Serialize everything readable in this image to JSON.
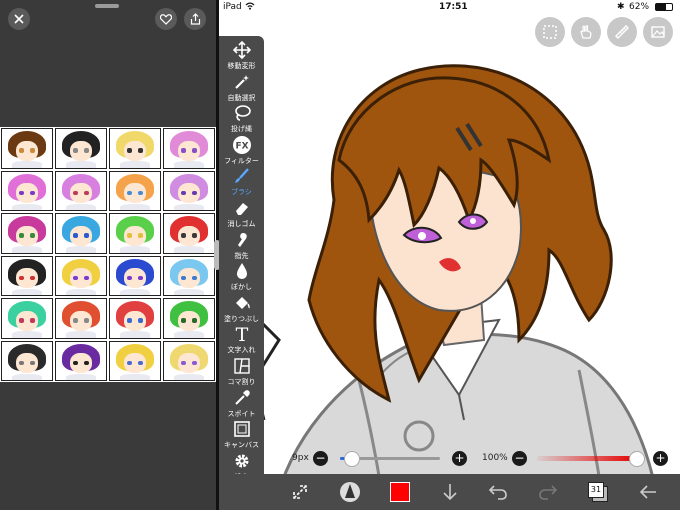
{
  "colors": {
    "accent": "#5aa8ff",
    "current_color": "#ff0000",
    "toolbar_bg": "#4a4a4a",
    "hair_main": "#a0550f"
  },
  "status_bar": {
    "device": "iPad",
    "time": "17:51",
    "battery": "62%",
    "battery_level": 0.62
  },
  "left_pane": {
    "icons": [
      "close-icon",
      "heart-icon",
      "share-icon"
    ]
  },
  "top_tools": [
    "selection-icon",
    "hand-icon",
    "ruler-icon",
    "image-icon"
  ],
  "toolbar": {
    "items": [
      {
        "label": "移動変形",
        "icon": "move-transform-icon"
      },
      {
        "label": "自動選択",
        "icon": "magic-wand-icon"
      },
      {
        "label": "投げ縄",
        "icon": "lasso-icon"
      },
      {
        "label": "フィルター",
        "icon": "fx-filter-icon",
        "glyph": "FX"
      },
      {
        "label": "ブラシ",
        "icon": "brush-icon",
        "active": true
      },
      {
        "label": "消しゴム",
        "icon": "eraser-icon"
      },
      {
        "label": "指先",
        "icon": "finger-icon"
      },
      {
        "label": "ぼかし",
        "icon": "blur-drop-icon"
      },
      {
        "label": "塗りつぶし",
        "icon": "bucket-fill-icon"
      },
      {
        "label": "文字入れ",
        "icon": "text-tool-icon",
        "glyph": "T"
      },
      {
        "label": "コマ割り",
        "icon": "panel-split-icon"
      },
      {
        "label": "スポイト",
        "icon": "eyedropper-icon"
      },
      {
        "label": "キャンバス",
        "icon": "canvas-icon"
      },
      {
        "label": "設定",
        "icon": "gear-icon"
      }
    ]
  },
  "brush_size": {
    "label": "9px",
    "value": 0.12,
    "minus": "−",
    "plus": "+"
  },
  "opacity": {
    "label": "100%",
    "value": 1.0,
    "minus": "−",
    "plus": "+"
  },
  "bottom_bar": {
    "layer_count": "31",
    "icons": [
      "transform-arrows-icon",
      "brush-preview-icon",
      "color-swatch",
      "download-arrow-icon",
      "undo-icon",
      "redo-icon",
      "layers-icon",
      "back-arrow-icon"
    ]
  }
}
